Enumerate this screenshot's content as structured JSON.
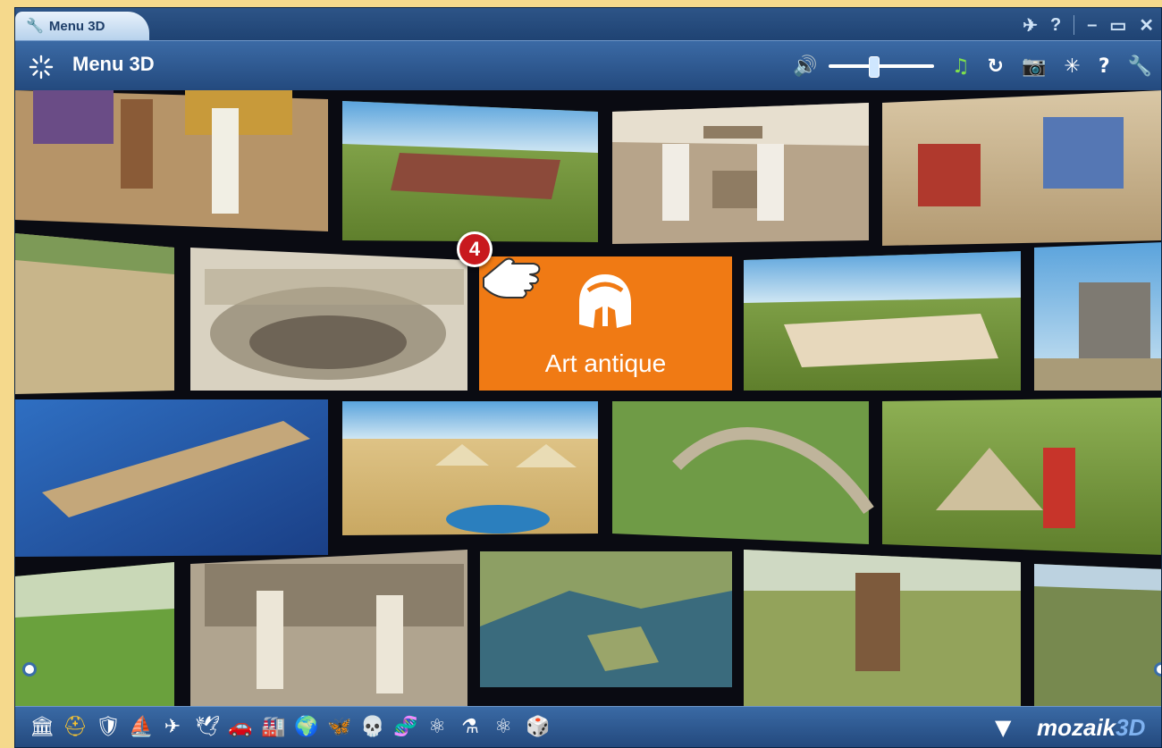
{
  "tab": {
    "label": "Menu 3D"
  },
  "header": {
    "title": "Menu 3D"
  },
  "volume": {
    "level": 0.42
  },
  "highlight": {
    "label": "Art antique",
    "step_badge": "4"
  },
  "footer": {
    "brand_main": "mozaik",
    "brand_suffix": "3D",
    "categories": [
      {
        "icon": "column-icon",
        "glyph": "🏛"
      },
      {
        "icon": "spartan-helmet-icon",
        "glyph": "⛑",
        "active": true
      },
      {
        "icon": "shield-icon",
        "glyph": "🛡"
      },
      {
        "icon": "ship-icon",
        "glyph": "⛵"
      },
      {
        "icon": "airplane-icon",
        "glyph": "✈"
      },
      {
        "icon": "origami-bird-icon",
        "glyph": "🕊"
      },
      {
        "icon": "car-icon",
        "glyph": "🚗"
      },
      {
        "icon": "factory-icon",
        "glyph": "🏭"
      },
      {
        "icon": "globe-icon",
        "glyph": "🌍"
      },
      {
        "icon": "butterfly-icon",
        "glyph": "🦋"
      },
      {
        "icon": "skull-icon",
        "glyph": "💀"
      },
      {
        "icon": "dna-icon",
        "glyph": "🧬"
      },
      {
        "icon": "molecule-icon",
        "glyph": "⚛"
      },
      {
        "icon": "flask-icon",
        "glyph": "⚗"
      },
      {
        "icon": "atom-icon",
        "glyph": "⚛"
      },
      {
        "icon": "dice-icon",
        "glyph": "🎲"
      }
    ]
  },
  "colors": {
    "accent": "#f07a14",
    "window": "#1d3f6e",
    "header": "#2f5a92",
    "badge": "#c8191e"
  }
}
